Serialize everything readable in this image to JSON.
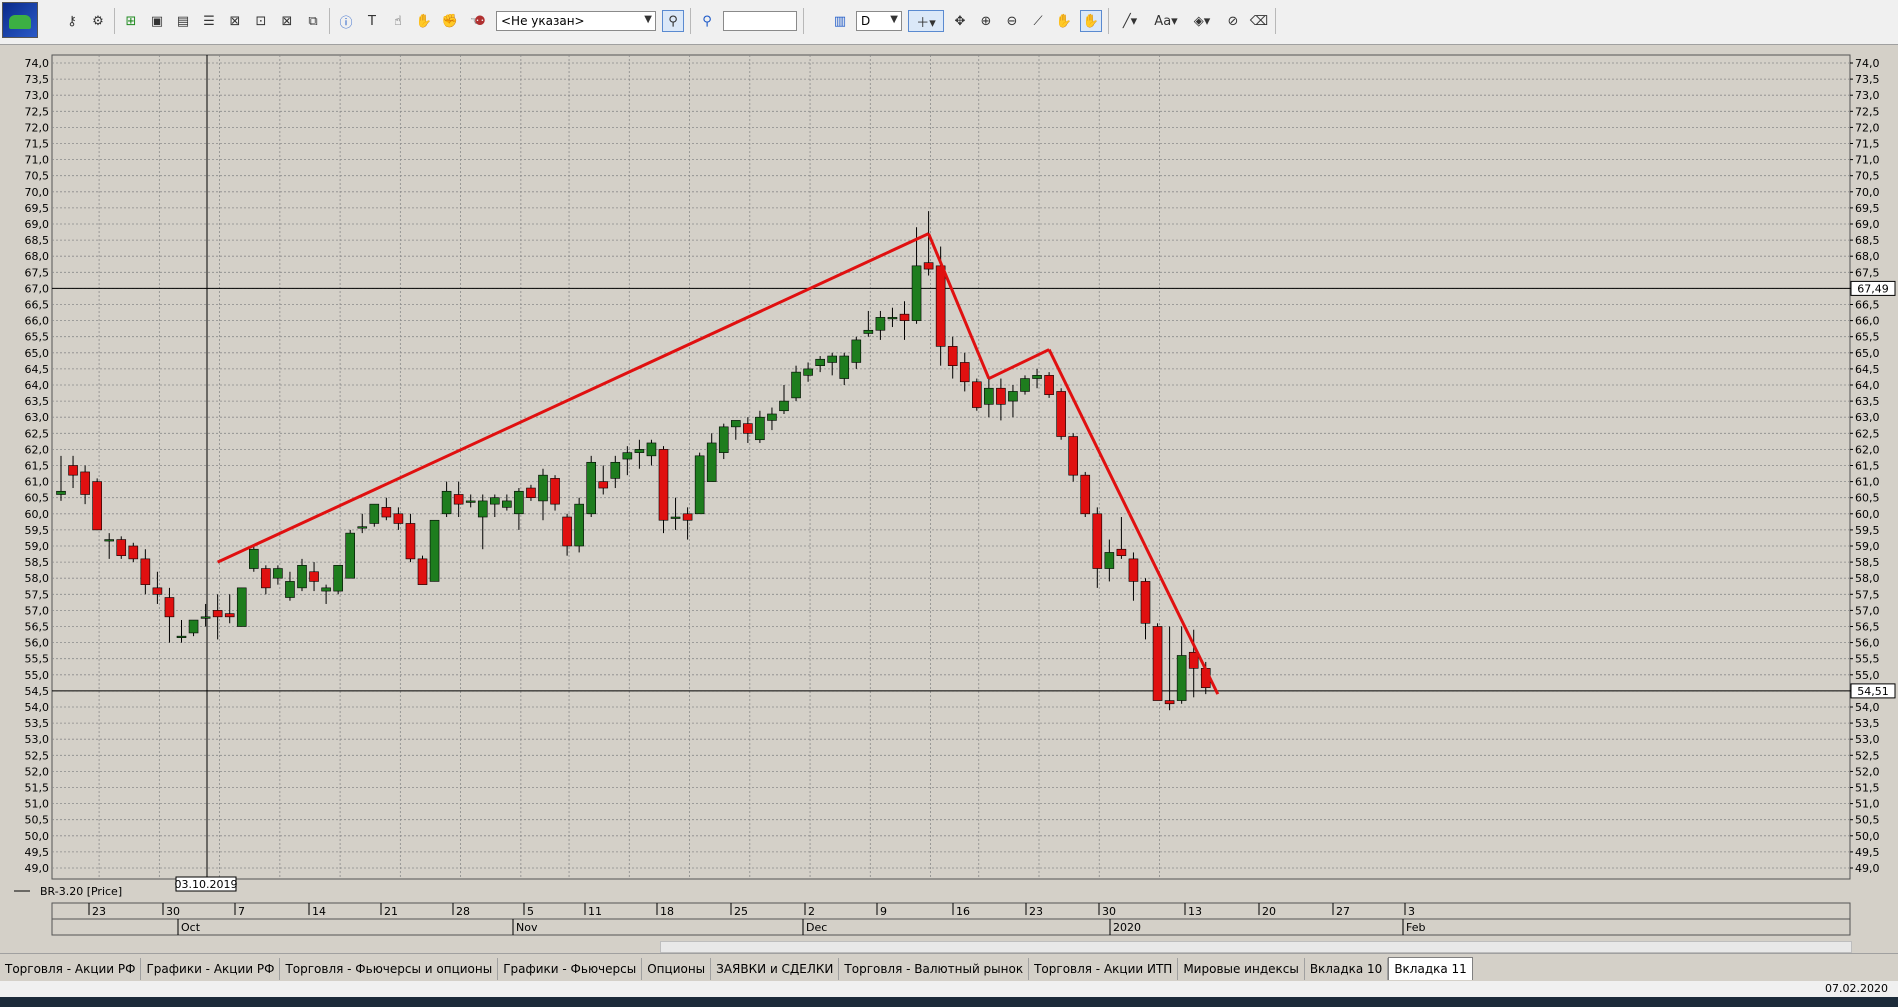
{
  "toolbar": {
    "security_combo": "<Не указан>",
    "search_value": "",
    "interval_combo": "D",
    "font_label": "Aa"
  },
  "chart_legend": "BR-3.20 [Price]",
  "crosshair_date": "03.10.2019",
  "price_badges": [
    "67,49",
    "54,51"
  ],
  "x_axis": {
    "day_ticks": [
      "23",
      "30",
      "7",
      "14",
      "21",
      "28",
      "5",
      "11",
      "18",
      "25",
      "2",
      "9",
      "16",
      "23",
      "30",
      "13",
      "20",
      "27",
      "3"
    ],
    "month_labels": [
      "Oct",
      "Nov",
      "Dec",
      "2020",
      "Feb"
    ]
  },
  "tabs": [
    "Торговля - Акции РФ",
    "Графики - Акции РФ",
    "Торговля - Фьючерсы и опционы",
    "Графики - Фьючерсы",
    "Опционы",
    "ЗАЯВКИ и СДЕЛКИ",
    "Торговля - Валютный рынок",
    "Торговля - Акции ИТП",
    "Мировые индексы",
    "Вкладка 10",
    "Вкладка 11"
  ],
  "active_tab": "Вкладка 11",
  "status_date": "07.02.2020",
  "colors": {
    "up": "#1e7d1e",
    "down": "#e01010",
    "trend": "#e01010",
    "grid": "#8a8a8a",
    "plot_bg": "#d4d0c8"
  },
  "chart_data": {
    "type": "candlestick",
    "ylim": [
      49.0,
      74.0
    ],
    "y_ticks": [
      "74,0",
      "73,5",
      "73,0",
      "72,5",
      "72,0",
      "71,5",
      "71,0",
      "70,5",
      "70,0",
      "69,5",
      "69,0",
      "68,5",
      "68,0",
      "67,5",
      "67,0",
      "66,5",
      "66,0",
      "65,5",
      "65,0",
      "64,5",
      "64,0",
      "63,5",
      "63,0",
      "62,5",
      "62,0",
      "61,5",
      "61,0",
      "60,5",
      "60,0",
      "59,5",
      "59,0",
      "58,5",
      "58,0",
      "57,5",
      "57,0",
      "56,5",
      "56,0",
      "55,5",
      "55,0",
      "54,5",
      "54,0",
      "53,5",
      "53,0",
      "52,5",
      "52,0",
      "51,5",
      "51,0",
      "50,5",
      "50,0",
      "49,5",
      "49,0"
    ],
    "candles": [
      {
        "o": 60.6,
        "h": 61.8,
        "l": 60.4,
        "c": 60.7
      },
      {
        "o": 61.5,
        "h": 61.8,
        "l": 60.8,
        "c": 61.2
      },
      {
        "o": 61.3,
        "h": 61.5,
        "l": 60.3,
        "c": 60.6
      },
      {
        "o": 61.0,
        "h": 61.1,
        "l": 59.5,
        "c": 59.5
      },
      {
        "o": 59.2,
        "h": 59.4,
        "l": 58.6,
        "c": 59.2
      },
      {
        "o": 59.2,
        "h": 59.3,
        "l": 58.6,
        "c": 58.7
      },
      {
        "o": 59.0,
        "h": 59.1,
        "l": 58.5,
        "c": 58.6
      },
      {
        "o": 58.6,
        "h": 58.9,
        "l": 57.5,
        "c": 57.8
      },
      {
        "o": 57.7,
        "h": 58.2,
        "l": 57.2,
        "c": 57.5
      },
      {
        "o": 57.4,
        "h": 57.7,
        "l": 56.0,
        "c": 56.8
      },
      {
        "o": 56.2,
        "h": 56.7,
        "l": 56.0,
        "c": 56.2
      },
      {
        "o": 56.3,
        "h": 56.7,
        "l": 56.2,
        "c": 56.7
      },
      {
        "o": 56.8,
        "h": 57.2,
        "l": 56.5,
        "c": 56.8
      },
      {
        "o": 57.0,
        "h": 57.5,
        "l": 56.1,
        "c": 56.8
      },
      {
        "o": 56.9,
        "h": 57.5,
        "l": 56.6,
        "c": 56.8
      },
      {
        "o": 56.5,
        "h": 57.7,
        "l": 56.5,
        "c": 57.7
      },
      {
        "o": 58.3,
        "h": 59.0,
        "l": 58.2,
        "c": 58.9
      },
      {
        "o": 58.3,
        "h": 58.4,
        "l": 57.5,
        "c": 57.7
      },
      {
        "o": 58.0,
        "h": 58.4,
        "l": 57.8,
        "c": 58.3
      },
      {
        "o": 57.4,
        "h": 58.2,
        "l": 57.3,
        "c": 57.9
      },
      {
        "o": 57.7,
        "h": 58.6,
        "l": 57.6,
        "c": 58.4
      },
      {
        "o": 58.2,
        "h": 58.5,
        "l": 57.6,
        "c": 57.9
      },
      {
        "o": 57.6,
        "h": 57.8,
        "l": 57.2,
        "c": 57.7
      },
      {
        "o": 57.6,
        "h": 58.3,
        "l": 57.5,
        "c": 58.4
      },
      {
        "o": 58.0,
        "h": 59.5,
        "l": 58.0,
        "c": 59.4
      },
      {
        "o": 59.6,
        "h": 60.0,
        "l": 59.4,
        "c": 59.6
      },
      {
        "o": 59.7,
        "h": 60.3,
        "l": 59.6,
        "c": 60.3
      },
      {
        "o": 60.2,
        "h": 60.5,
        "l": 59.8,
        "c": 59.9
      },
      {
        "o": 60.0,
        "h": 60.2,
        "l": 59.5,
        "c": 59.7
      },
      {
        "o": 59.7,
        "h": 60.0,
        "l": 58.5,
        "c": 58.6
      },
      {
        "o": 58.6,
        "h": 58.7,
        "l": 57.8,
        "c": 57.8
      },
      {
        "o": 57.9,
        "h": 59.8,
        "l": 57.9,
        "c": 59.8
      },
      {
        "o": 60.0,
        "h": 61.0,
        "l": 59.9,
        "c": 60.7
      },
      {
        "o": 60.6,
        "h": 61.0,
        "l": 59.9,
        "c": 60.3
      },
      {
        "o": 60.4,
        "h": 60.6,
        "l": 60.2,
        "c": 60.4
      },
      {
        "o": 59.9,
        "h": 60.6,
        "l": 58.9,
        "c": 60.4
      },
      {
        "o": 60.3,
        "h": 60.6,
        "l": 59.9,
        "c": 60.5
      },
      {
        "o": 60.2,
        "h": 60.6,
        "l": 60.1,
        "c": 60.4
      },
      {
        "o": 60.0,
        "h": 60.8,
        "l": 59.5,
        "c": 60.7
      },
      {
        "o": 60.8,
        "h": 60.9,
        "l": 60.4,
        "c": 60.5
      },
      {
        "o": 60.4,
        "h": 61.4,
        "l": 59.8,
        "c": 61.2
      },
      {
        "o": 61.1,
        "h": 61.2,
        "l": 60.1,
        "c": 60.3
      },
      {
        "o": 59.9,
        "h": 60.0,
        "l": 58.7,
        "c": 59.0
      },
      {
        "o": 59.0,
        "h": 60.5,
        "l": 58.8,
        "c": 60.3
      },
      {
        "o": 60.0,
        "h": 61.8,
        "l": 59.9,
        "c": 61.6
      },
      {
        "o": 61.0,
        "h": 61.5,
        "l": 60.6,
        "c": 60.8
      },
      {
        "o": 61.1,
        "h": 61.8,
        "l": 60.8,
        "c": 61.6
      },
      {
        "o": 61.7,
        "h": 62.1,
        "l": 61.2,
        "c": 61.9
      },
      {
        "o": 61.9,
        "h": 62.3,
        "l": 61.4,
        "c": 62.0
      },
      {
        "o": 61.8,
        "h": 62.3,
        "l": 61.5,
        "c": 62.2
      },
      {
        "o": 62.0,
        "h": 62.1,
        "l": 59.4,
        "c": 59.8
      },
      {
        "o": 59.9,
        "h": 60.5,
        "l": 59.5,
        "c": 59.9
      },
      {
        "o": 60.0,
        "h": 60.2,
        "l": 59.2,
        "c": 59.8
      },
      {
        "o": 60.0,
        "h": 61.9,
        "l": 60.0,
        "c": 61.8
      },
      {
        "o": 61.0,
        "h": 62.5,
        "l": 61.0,
        "c": 62.2
      },
      {
        "o": 61.9,
        "h": 62.8,
        "l": 61.7,
        "c": 62.7
      },
      {
        "o": 62.7,
        "h": 62.9,
        "l": 62.3,
        "c": 62.9
      },
      {
        "o": 62.8,
        "h": 63.0,
        "l": 62.2,
        "c": 62.5
      },
      {
        "o": 62.3,
        "h": 63.2,
        "l": 62.2,
        "c": 63.0
      },
      {
        "o": 62.9,
        "h": 63.3,
        "l": 62.6,
        "c": 63.1
      },
      {
        "o": 63.2,
        "h": 64.0,
        "l": 63.1,
        "c": 63.5
      },
      {
        "o": 63.6,
        "h": 64.6,
        "l": 63.5,
        "c": 64.4
      },
      {
        "o": 64.3,
        "h": 64.7,
        "l": 64.1,
        "c": 64.5
      },
      {
        "o": 64.6,
        "h": 64.9,
        "l": 64.4,
        "c": 64.8
      },
      {
        "o": 64.7,
        "h": 65.0,
        "l": 64.3,
        "c": 64.9
      },
      {
        "o": 64.2,
        "h": 65.0,
        "l": 64.0,
        "c": 64.9
      },
      {
        "o": 64.7,
        "h": 65.5,
        "l": 64.5,
        "c": 65.4
      },
      {
        "o": 65.6,
        "h": 66.3,
        "l": 65.5,
        "c": 65.7
      },
      {
        "o": 65.7,
        "h": 66.3,
        "l": 65.4,
        "c": 66.1
      },
      {
        "o": 66.1,
        "h": 66.4,
        "l": 65.8,
        "c": 66.1
      },
      {
        "o": 66.2,
        "h": 66.6,
        "l": 65.4,
        "c": 66.0
      },
      {
        "o": 66.0,
        "h": 68.9,
        "l": 65.9,
        "c": 67.7
      },
      {
        "o": 67.8,
        "h": 69.4,
        "l": 67.4,
        "c": 67.6
      },
      {
        "o": 67.7,
        "h": 68.3,
        "l": 64.6,
        "c": 65.2
      },
      {
        "o": 65.2,
        "h": 65.5,
        "l": 64.2,
        "c": 64.6
      },
      {
        "o": 64.7,
        "h": 65.0,
        "l": 63.8,
        "c": 64.1
      },
      {
        "o": 64.1,
        "h": 64.2,
        "l": 63.2,
        "c": 63.3
      },
      {
        "o": 63.4,
        "h": 64.2,
        "l": 63.0,
        "c": 63.9
      },
      {
        "o": 63.9,
        "h": 64.2,
        "l": 62.9,
        "c": 63.4
      },
      {
        "o": 63.5,
        "h": 64.0,
        "l": 63.0,
        "c": 63.8
      },
      {
        "o": 63.8,
        "h": 64.3,
        "l": 63.7,
        "c": 64.2
      },
      {
        "o": 64.2,
        "h": 64.5,
        "l": 63.9,
        "c": 64.3
      },
      {
        "o": 64.3,
        "h": 64.4,
        "l": 63.6,
        "c": 63.7
      },
      {
        "o": 63.8,
        "h": 63.9,
        "l": 62.3,
        "c": 62.4
      },
      {
        "o": 62.4,
        "h": 62.5,
        "l": 61.0,
        "c": 61.2
      },
      {
        "o": 61.2,
        "h": 61.3,
        "l": 59.9,
        "c": 60.0
      },
      {
        "o": 60.0,
        "h": 60.2,
        "l": 57.7,
        "c": 58.3
      },
      {
        "o": 58.3,
        "h": 59.2,
        "l": 57.9,
        "c": 58.8
      },
      {
        "o": 58.9,
        "h": 59.9,
        "l": 58.6,
        "c": 58.7
      },
      {
        "o": 58.6,
        "h": 58.8,
        "l": 57.3,
        "c": 57.9
      },
      {
        "o": 57.9,
        "h": 58.0,
        "l": 56.1,
        "c": 56.6
      },
      {
        "o": 56.5,
        "h": 56.6,
        "l": 54.2,
        "c": 54.2
      },
      {
        "o": 54.2,
        "h": 56.5,
        "l": 53.9,
        "c": 54.1
      },
      {
        "o": 54.2,
        "h": 56.5,
        "l": 54.1,
        "c": 55.6
      },
      {
        "o": 55.7,
        "h": 56.4,
        "l": 54.3,
        "c": 55.2
      },
      {
        "o": 55.2,
        "h": 55.4,
        "l": 54.4,
        "c": 54.6
      }
    ],
    "trend_lines": [
      [
        {
          "i": 13,
          "p": 58.5
        },
        {
          "i": 72,
          "p": 68.7
        }
      ],
      [
        {
          "i": 72,
          "p": 68.7
        },
        {
          "i": 77,
          "p": 64.2
        }
      ],
      [
        {
          "i": 77,
          "p": 64.2
        },
        {
          "i": 82,
          "p": 65.1
        }
      ],
      [
        {
          "i": 82,
          "p": 65.1
        },
        {
          "i": 96,
          "p": 54.4
        }
      ]
    ],
    "h_lines": [
      67.0,
      54.5
    ]
  }
}
